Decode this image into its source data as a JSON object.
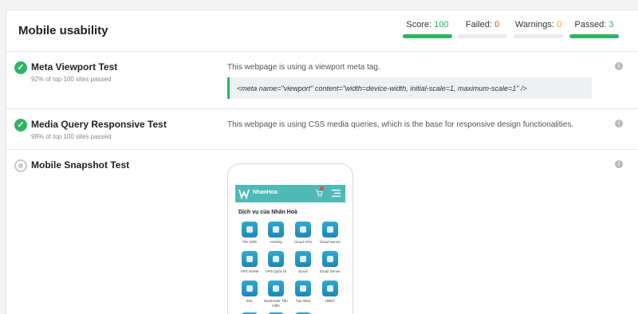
{
  "header": {
    "title": "Mobile usability",
    "stats": [
      {
        "label": "Score: ",
        "value": "100",
        "color": "#2db463",
        "bar_filled": true
      },
      {
        "label": "Failed: ",
        "value": "0",
        "color": "#e2483d",
        "bar_filled": false
      },
      {
        "label": "Warnings: ",
        "value": "0",
        "color": "#f5a623",
        "bar_filled": false
      },
      {
        "label": "Passed: ",
        "value": "3",
        "color": "#2db463",
        "bar_filled": true
      }
    ]
  },
  "tests": [
    {
      "status": "passed",
      "title": "Meta Viewport Test",
      "subtitle": "92% of top 100 sites passed",
      "description": "This webpage is using a viewport meta tag.",
      "code": "<meta name=\"viewport\" content=\"width=device-width, initial-scale=1, maximum-scale=1\" />",
      "info_icon": "i"
    },
    {
      "status": "passed",
      "title": "Media Query Responsive Test",
      "subtitle": "98% of top 100 sites passed",
      "description": "This webpage is using CSS media queries, which is the base for responsive design functionalities.",
      "info_icon": "i"
    },
    {
      "status": "pending",
      "title": "Mobile Snapshot Test",
      "info_icon": "i"
    }
  ],
  "snapshot": {
    "brand": "NhanHoa",
    "cart_count_icon": "cart-icon",
    "section_title": "Dịch vụ của Nhân Hoà",
    "services": [
      {
        "label": "Tên miền"
      },
      {
        "label": "Hosting"
      },
      {
        "label": "Cloud VPS"
      },
      {
        "label": "Cloud Server"
      },
      {
        "label": "VPS NVMe"
      },
      {
        "label": "VPS Quốc tế"
      },
      {
        "label": "Email"
      },
      {
        "label": "Email Server"
      },
      {
        "label": "SSL"
      },
      {
        "label": "Backorder Tên miền"
      },
      {
        "label": "Tạo Web"
      },
      {
        "label": "HĐĐT"
      },
      {
        "label": ""
      },
      {
        "label": ""
      },
      {
        "label": ""
      }
    ]
  },
  "colors": {
    "accent": "#2db463",
    "teal": "#4fb9b6"
  }
}
